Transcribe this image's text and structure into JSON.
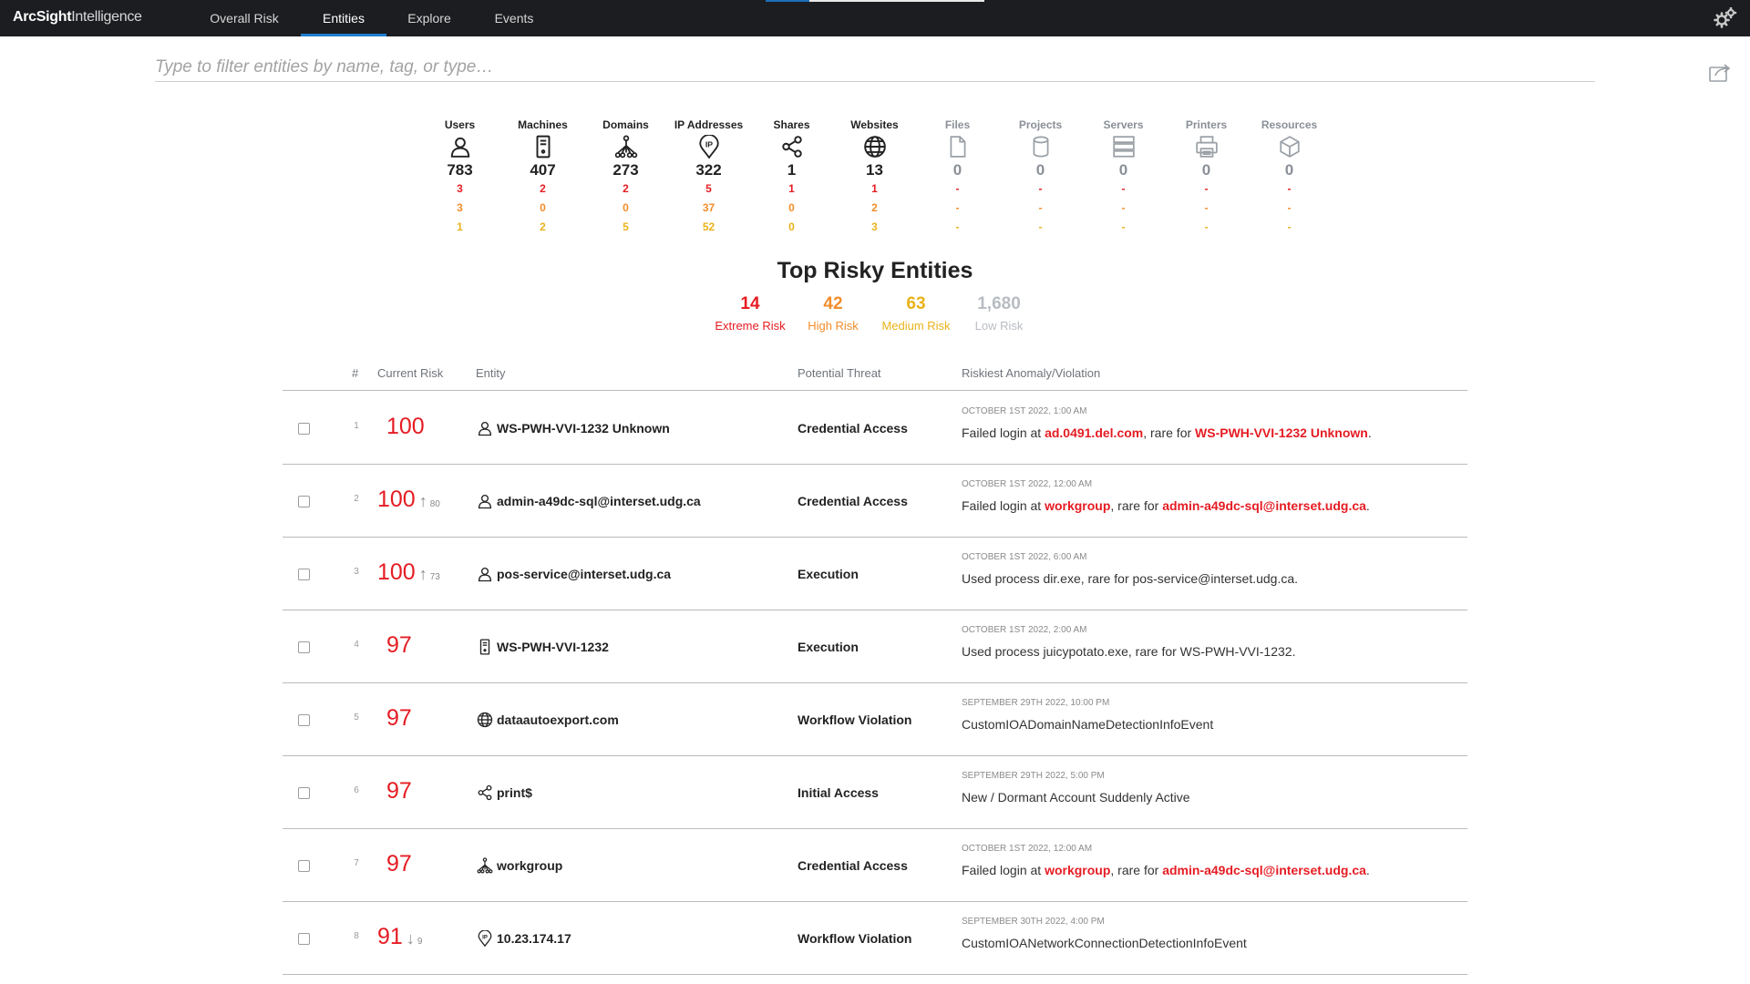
{
  "app": {
    "brand_bold": "ArcSight",
    "brand_light": "Intelligence"
  },
  "nav": {
    "tabs": [
      "Overall Risk",
      "Entities",
      "Explore",
      "Events"
    ],
    "active": "Entities"
  },
  "filter": {
    "placeholder": "Type to filter entities by name, tag, or type…",
    "value": ""
  },
  "entity_types": [
    {
      "name": "Users",
      "icon": "user-icon",
      "count": "783",
      "extreme": "3",
      "high": "3",
      "medium": "1"
    },
    {
      "name": "Machines",
      "icon": "machine-icon",
      "count": "407",
      "extreme": "2",
      "high": "0",
      "medium": "2"
    },
    {
      "name": "Domains",
      "icon": "domain-icon",
      "count": "273",
      "extreme": "2",
      "high": "0",
      "medium": "5"
    },
    {
      "name": "IP Addresses",
      "icon": "ip-address-icon",
      "count": "322",
      "extreme": "5",
      "high": "37",
      "medium": "52"
    },
    {
      "name": "Shares",
      "icon": "share-icon",
      "count": "1",
      "extreme": "1",
      "high": "0",
      "medium": "0"
    },
    {
      "name": "Websites",
      "icon": "website-icon",
      "count": "13",
      "extreme": "1",
      "high": "2",
      "medium": "3"
    },
    {
      "name": "Files",
      "icon": "file-icon",
      "count": "0",
      "extreme": "-",
      "high": "-",
      "medium": "-"
    },
    {
      "name": "Projects",
      "icon": "project-icon",
      "count": "0",
      "extreme": "-",
      "high": "-",
      "medium": "-"
    },
    {
      "name": "Servers",
      "icon": "server-icon",
      "count": "0",
      "extreme": "-",
      "high": "-",
      "medium": "-"
    },
    {
      "name": "Printers",
      "icon": "printer-icon",
      "count": "0",
      "extreme": "-",
      "high": "-",
      "medium": "-"
    },
    {
      "name": "Resources",
      "icon": "resource-icon",
      "count": "0",
      "extreme": "-",
      "high": "-",
      "medium": "-"
    }
  ],
  "top_risky": {
    "title": "Top Risky Entities",
    "summary": [
      {
        "value": "14",
        "label": "Extreme Risk",
        "color": "#e51c23"
      },
      {
        "value": "42",
        "label": "High Risk",
        "color": "#f28d2b"
      },
      {
        "value": "63",
        "label": "Medium Risk",
        "color": "#e9b21b"
      },
      {
        "value": "1,680",
        "label": "Low Risk",
        "color": "#b8bcc2"
      }
    ]
  },
  "table": {
    "headers": {
      "num": "#",
      "risk": "Current Risk",
      "entity": "Entity",
      "threat": "Potential Threat",
      "anomaly": "Riskiest Anomaly/Violation"
    },
    "rows": [
      {
        "idx": "1",
        "risk": "100",
        "trend": "",
        "prev": "",
        "icon": "user-icon",
        "entity": "WS-PWH-VVI-1232 Unknown",
        "threat": "Credential Access",
        "time": "OCTOBER 1ST 2022, 1:00 AM",
        "desc": [
          [
            "Failed login at ",
            false
          ],
          [
            "ad.0491.del.com",
            true
          ],
          [
            ", rare for ",
            false
          ],
          [
            "WS-PWH-VVI-1232 Unknown",
            true
          ],
          [
            ".",
            false
          ]
        ]
      },
      {
        "idx": "2",
        "risk": "100",
        "trend": "↑",
        "prev": "80",
        "icon": "user-icon",
        "entity": "admin-a49dc-sql@interset.udg.ca",
        "threat": "Credential Access",
        "time": "OCTOBER 1ST 2022, 12:00 AM",
        "desc": [
          [
            "Failed login at ",
            false
          ],
          [
            "workgroup",
            true
          ],
          [
            ", rare for ",
            false
          ],
          [
            "admin-a49dc-sql@interset.udg.ca",
            true
          ],
          [
            ".",
            false
          ]
        ]
      },
      {
        "idx": "3",
        "risk": "100",
        "trend": "↑",
        "prev": "73",
        "icon": "user-icon",
        "entity": "pos-service@interset.udg.ca",
        "threat": "Execution",
        "time": "OCTOBER 1ST 2022, 6:00 AM",
        "desc": [
          [
            "Used process dir.exe, rare for pos-service@interset.udg.ca.",
            false
          ]
        ]
      },
      {
        "idx": "4",
        "risk": "97",
        "trend": "",
        "prev": "",
        "icon": "machine-icon",
        "entity": "WS-PWH-VVI-1232",
        "threat": "Execution",
        "time": "OCTOBER 1ST 2022, 2:00 AM",
        "desc": [
          [
            "Used process juicypotato.exe, rare for WS-PWH-VVI-1232.",
            false
          ]
        ]
      },
      {
        "idx": "5",
        "risk": "97",
        "trend": "",
        "prev": "",
        "icon": "website-icon",
        "entity": "dataautoexport.com",
        "threat": "Workflow Violation",
        "time": "SEPTEMBER 29TH 2022, 10:00 PM",
        "desc": [
          [
            "CustomIOADomainNameDetectionInfoEvent",
            false
          ]
        ]
      },
      {
        "idx": "6",
        "risk": "97",
        "trend": "",
        "prev": "",
        "icon": "share-icon",
        "entity": "print$",
        "threat": "Initial Access",
        "time": "SEPTEMBER 29TH 2022, 5:00 PM",
        "desc": [
          [
            "New / Dormant Account Suddenly Active",
            false
          ]
        ]
      },
      {
        "idx": "7",
        "risk": "97",
        "trend": "",
        "prev": "",
        "icon": "domain-icon",
        "entity": "workgroup",
        "threat": "Credential Access",
        "time": "OCTOBER 1ST 2022, 12:00 AM",
        "desc": [
          [
            "Failed login at ",
            false
          ],
          [
            "workgroup",
            true
          ],
          [
            ", rare for ",
            false
          ],
          [
            "admin-a49dc-sql@interset.udg.ca",
            true
          ],
          [
            ".",
            false
          ]
        ]
      },
      {
        "idx": "8",
        "risk": "91",
        "trend": "↓",
        "prev": "9",
        "icon": "ip-address-icon",
        "entity": "10.23.174.17",
        "threat": "Workflow Violation",
        "time": "SEPTEMBER 30TH 2022, 4:00 PM",
        "desc": [
          [
            "CustomIOANetworkConnectionDetectionInfoEvent",
            false
          ]
        ]
      }
    ]
  }
}
